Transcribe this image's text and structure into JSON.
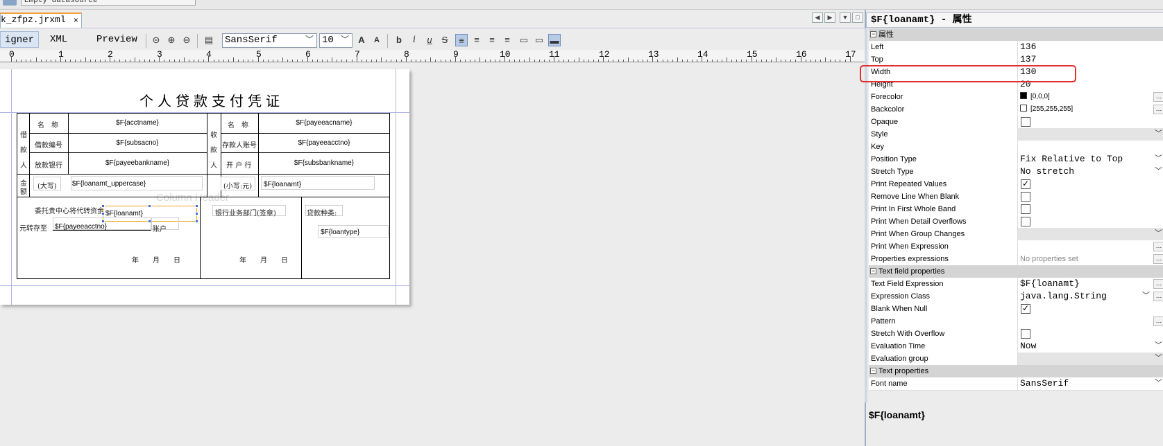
{
  "topbar": {
    "datasource_text": "Empty datasource"
  },
  "tab": {
    "title": "k_zfpz.jrxml",
    "close": "×"
  },
  "toolbar": {
    "modes": [
      "igner",
      "XML",
      "Preview"
    ],
    "font_name": "SansSerif",
    "font_size": "10",
    "icons": [
      "zoom-normal-icon",
      "zoom-in-icon",
      "zoom-out-icon",
      "paste-icon",
      "increase-font-icon",
      "decrease-font-icon",
      "bold-icon",
      "italic-icon",
      "underline-icon",
      "strikethrough-icon",
      "align-left-icon",
      "align-justify-icon",
      "align-center-icon",
      "align-right-icon",
      "valign-top-icon",
      "valign-middle-icon",
      "valign-bottom-icon"
    ]
  },
  "ruler": {
    "labels": [
      "0",
      "1",
      "2",
      "3",
      "4",
      "5",
      "6",
      "7",
      "8",
      "9",
      "10",
      "11",
      "12",
      "13",
      "14",
      "15",
      "16",
      "17"
    ]
  },
  "report": {
    "title": "个人贷款支付凭证",
    "ghost_column_header": "Column Header",
    "borrower_side": [
      "借",
      "款",
      "人"
    ],
    "payee_side": [
      "收",
      "款",
      "人"
    ],
    "amount_side": [
      "金",
      "额"
    ],
    "labels": {
      "name_left": "名　称",
      "loan_no": "借款编号",
      "bank_left": "放款银行",
      "name_right": "名　称",
      "payee_acct": "存款人账号",
      "bank_right": "开 户 行",
      "upper": "(大写)",
      "lower": "(小写:元)",
      "entrust": "委托贵中心将代转资金",
      "transfer_to": "元转存至",
      "account": "账户",
      "bank_dept": "银行业务部门(签章)",
      "loan_type": "贷款种类:",
      "year": "年",
      "month": "月",
      "day": "日"
    },
    "fields": {
      "acctname": "$F{acctname}",
      "subsacno": "$F{subsacno}",
      "payeebankname": "$F{payeebankname}",
      "payeeacname": "$F{payeeacname}",
      "payeeacctno": "$F{payeeacctno}",
      "subsbankname": "$F{subsbankname}",
      "loanamt_uppercase": "$F{loanamt_uppercase}",
      "loanamt_small": "$F{loanamt}",
      "loanamt_selected": "$F{loanamt}",
      "payeeacctno2": "$F{payeeacctno}",
      "loantype": "$F{loantype}"
    }
  },
  "properties_panel": {
    "title": "$F{loanamt} - 属性",
    "groups": {
      "attrs": "属性",
      "text_field": "Text field properties",
      "text": "Text properties"
    },
    "rows": {
      "left": {
        "name": "Left",
        "value": "136"
      },
      "top": {
        "name": "Top",
        "value": "137"
      },
      "width": {
        "name": "Width",
        "value": "130"
      },
      "height": {
        "name": "Height",
        "value": "20"
      },
      "forecolor": {
        "name": "Forecolor",
        "value": "[0,0,0]"
      },
      "backcolor": {
        "name": "Backcolor",
        "value": "[255,255,255]"
      },
      "opaque": {
        "name": "Opaque"
      },
      "style": {
        "name": "Style"
      },
      "key": {
        "name": "Key"
      },
      "position_type": {
        "name": "Position Type",
        "value": "Fix Relative to Top"
      },
      "stretch_type": {
        "name": "Stretch Type",
        "value": "No stretch"
      },
      "print_repeated": {
        "name": "Print Repeated Values"
      },
      "remove_line": {
        "name": "Remove Line When Blank"
      },
      "print_first": {
        "name": "Print In First Whole Band"
      },
      "print_detail": {
        "name": "Print When Detail Overflows"
      },
      "print_group": {
        "name": "Print When Group Changes"
      },
      "print_expr": {
        "name": "Print When Expression"
      },
      "prop_expr": {
        "name": "Properties expressions",
        "value": "No properties set"
      },
      "tf_expr": {
        "name": "Text Field Expression",
        "value": "$F{loanamt}"
      },
      "expr_class": {
        "name": "Expression Class",
        "value": "java.lang.String"
      },
      "blank_null": {
        "name": "Blank When Null"
      },
      "pattern": {
        "name": "Pattern"
      },
      "stretch_overflow": {
        "name": "Stretch With Overflow"
      },
      "eval_time": {
        "name": "Evaluation Time",
        "value": "Now"
      },
      "eval_group": {
        "name": "Evaluation group"
      },
      "font_name": {
        "name": "Font name",
        "value": "SansSerif"
      }
    },
    "checks": {
      "opaque": false,
      "print_repeated": true,
      "remove_line": false,
      "print_first": false,
      "print_detail": false,
      "blank_null": true,
      "stretch_overflow": false
    },
    "description": "$F{loanamt}",
    "colors": {
      "forecolor": "#000000",
      "backcolor": "#ffffff",
      "highlight": "#e03030"
    }
  }
}
